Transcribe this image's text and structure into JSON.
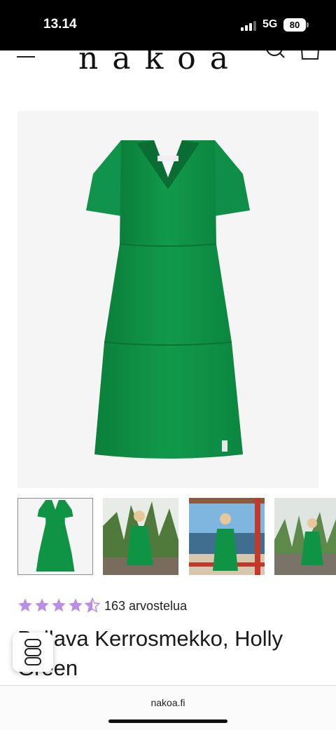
{
  "status": {
    "time": "13.14",
    "network": "5G",
    "battery": "80"
  },
  "header": {
    "logo": "nakoa",
    "menu_icon": "menu-icon",
    "search_icon": "search-icon",
    "cart_icon": "cart-icon"
  },
  "product": {
    "color": "#0f9446",
    "image_alt_icon": "green-tiered-dress",
    "thumbnails": [
      {
        "label": "product-front"
      },
      {
        "label": "model-sitting"
      },
      {
        "label": "model-balcony"
      },
      {
        "label": "model-standing"
      }
    ],
    "rating": 4.5,
    "rating_color": "#b98de8",
    "review_count": "163 arvostelua",
    "title": "Pellava Kerrosmekko, Holly Green"
  },
  "browser": {
    "url": "nakoa.fi"
  }
}
